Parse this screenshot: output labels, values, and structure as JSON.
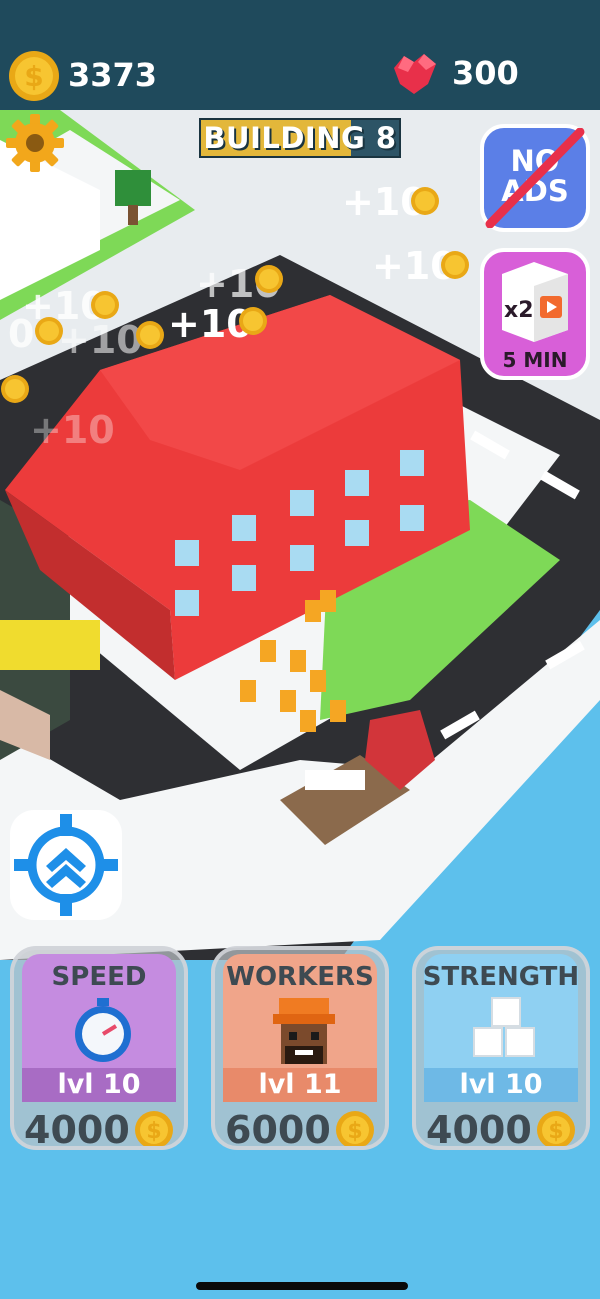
{
  "hud": {
    "coins": "3373",
    "gems": "300",
    "building_label": "BUILDING",
    "building_number": "8",
    "building_progress": 0.76
  },
  "side_buttons": {
    "no_ads_line1": "NO",
    "no_ads_line2": "ADS",
    "multiplier": "x2",
    "boost_duration": "5 MIN"
  },
  "floating_rewards": [
    "+10",
    "+10",
    "+10",
    "+10",
    "+10",
    "+10",
    "0",
    "+10"
  ],
  "upgrades": [
    {
      "title": "SPEED",
      "level": "lvl 10",
      "cost": "4000"
    },
    {
      "title": "WORKERS",
      "level": "lvl 11",
      "cost": "6000"
    },
    {
      "title": "STRENGTH",
      "level": "lvl 10",
      "cost": "4000"
    }
  ],
  "colors": {
    "sky": "#5dc0ec",
    "road": "#2e2f33",
    "grass": "#7ed957",
    "building": "#ec3b3b",
    "hud_bar": "#1f4a5c",
    "progress_fill": "#e3b73a",
    "no_ads": "#5b7fe7",
    "boost": "#d85fd8",
    "speed_card": "#c58ce0",
    "workers_card": "#f0a58a",
    "strength_card": "#8fd0f2"
  },
  "icons": {
    "coin": "dollar-coin-icon",
    "gem": "ruby-gem-icon",
    "settings": "gear-icon",
    "video": "video-ad-icon",
    "target": "crosshair-arrows-icon",
    "speed": "stopwatch-icon",
    "workers": "worker-helmet-icon",
    "strength": "stacked-blocks-icon"
  }
}
